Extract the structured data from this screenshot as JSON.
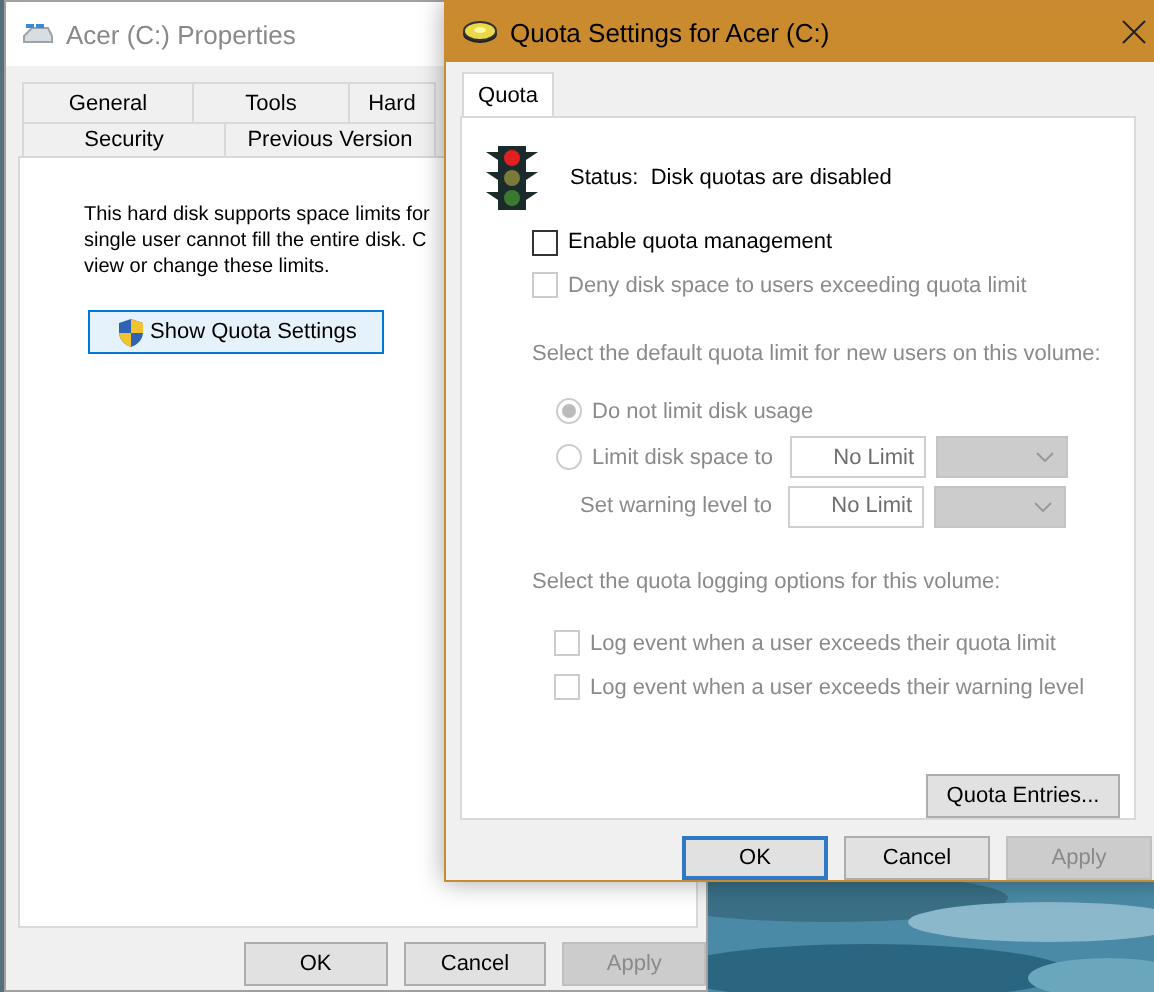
{
  "properties_window": {
    "title": "Acer (C:) Properties",
    "tab_rows": [
      [
        {
          "label": "General",
          "selected": false
        },
        {
          "label": "Tools",
          "selected": false
        },
        {
          "label": "Hard",
          "selected": false
        }
      ],
      [
        {
          "label": "Security",
          "selected": false
        },
        {
          "label": "Previous Version",
          "selected": false
        }
      ]
    ],
    "description": [
      "This hard disk supports space limits for",
      "single user cannot fill the entire disk. C",
      "view or change these limits."
    ],
    "show_quota_button": "Show Quota Settings",
    "buttons": [
      {
        "label": "OK",
        "disabled": false
      },
      {
        "label": "Cancel",
        "disabled": false
      },
      {
        "label": "Apply",
        "disabled": true
      }
    ]
  },
  "quota_window": {
    "title": "Quota Settings for Acer (C:)",
    "tabs": [
      {
        "label": "Quota",
        "selected": true
      }
    ],
    "status": "Status:  Disk quotas are disabled",
    "options": [
      {
        "label": "Enable quota management",
        "checked": false,
        "disabled": false
      },
      {
        "label": "Deny disk space to users exceeding quota limit",
        "checked": false,
        "disabled": true
      }
    ],
    "limit_heading": "Select the default quota limit for new users on this volume:",
    "limit_choices": [
      {
        "label": "Do not limit disk usage",
        "selected": true,
        "disabled": true
      },
      {
        "label": "Limit disk space to",
        "selected": false,
        "disabled": true,
        "value": "No Limit"
      }
    ],
    "warning": {
      "label": "Set warning level to",
      "value": "No Limit",
      "disabled": true
    },
    "logging_heading": "Select the quota logging options for this volume:",
    "logging_options": [
      {
        "label": "Log event when a user exceeds their quota limit",
        "checked": false,
        "disabled": true
      },
      {
        "label": "Log event when a user exceeds their warning level",
        "checked": false,
        "disabled": true
      }
    ],
    "entries_button": "Quota Entries...",
    "buttons": [
      {
        "label": "OK",
        "disabled": false,
        "default": true
      },
      {
        "label": "Cancel",
        "disabled": false,
        "default": false
      },
      {
        "label": "Apply",
        "disabled": true,
        "default": false
      }
    ]
  }
}
